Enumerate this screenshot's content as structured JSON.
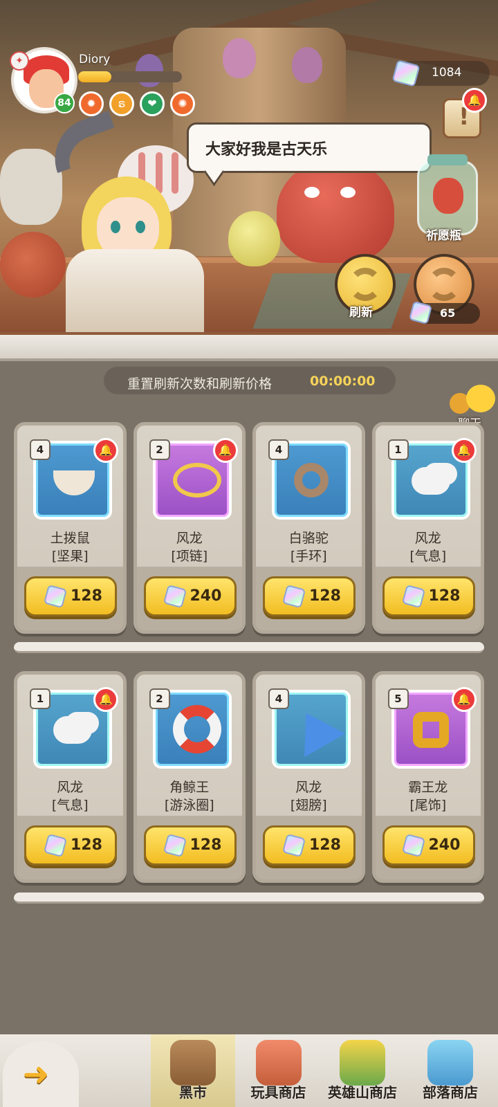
{
  "player": {
    "name": "Diory",
    "level": "84",
    "xp_fraction": 0.32
  },
  "currency": {
    "gems": "1084",
    "refresh_cost": "65"
  },
  "speech": "大家好我是古天乐",
  "wish_bottle_label": "祈愿瓶",
  "refresh_label": "刷新",
  "reset_bar": {
    "text": "重置刷新次数和刷新价格",
    "timer": "00:00:00"
  },
  "chat_label": "聊天",
  "items": [
    {
      "qty": "4",
      "name": "土拨鼠",
      "sub": "[坚果]",
      "price": "128",
      "rarity": "blue",
      "icon": "nut-icon",
      "alert": true
    },
    {
      "qty": "2",
      "name": "风龙",
      "sub": "[项链]",
      "price": "240",
      "rarity": "purple",
      "icon": "necklace-icon",
      "alert": true
    },
    {
      "qty": "4",
      "name": "白骆驼",
      "sub": "[手环]",
      "price": "128",
      "rarity": "blue",
      "icon": "bracelet-icon",
      "alert": false
    },
    {
      "qty": "1",
      "name": "风龙",
      "sub": "[气息]",
      "price": "128",
      "rarity": "cyan",
      "icon": "breath-icon",
      "alert": true
    },
    {
      "qty": "1",
      "name": "风龙",
      "sub": "[气息]",
      "price": "128",
      "rarity": "cyan",
      "icon": "breath-icon",
      "alert": true
    },
    {
      "qty": "2",
      "name": "角鲸王",
      "sub": "[游泳圈]",
      "price": "128",
      "rarity": "blue",
      "icon": "swim-ring-icon",
      "alert": false
    },
    {
      "qty": "4",
      "name": "风龙",
      "sub": "[翅膀]",
      "price": "128",
      "rarity": "cyan",
      "icon": "wing-icon",
      "alert": false
    },
    {
      "qty": "5",
      "name": "霸王龙",
      "sub": "[尾饰]",
      "price": "240",
      "rarity": "purple",
      "icon": "tail-ornament-icon",
      "alert": true
    }
  ],
  "nav": {
    "back_icon": "arrow-left-icon",
    "tabs": [
      {
        "label": "黑市",
        "active": true
      },
      {
        "label": "玩具商店",
        "active": false
      },
      {
        "label": "英雄山商店",
        "active": false
      },
      {
        "label": "部落商店",
        "active": false
      }
    ]
  },
  "colors": {
    "gold": "#f2bd22",
    "alert": "#ec3b3b",
    "timer": "#f6d35a"
  }
}
